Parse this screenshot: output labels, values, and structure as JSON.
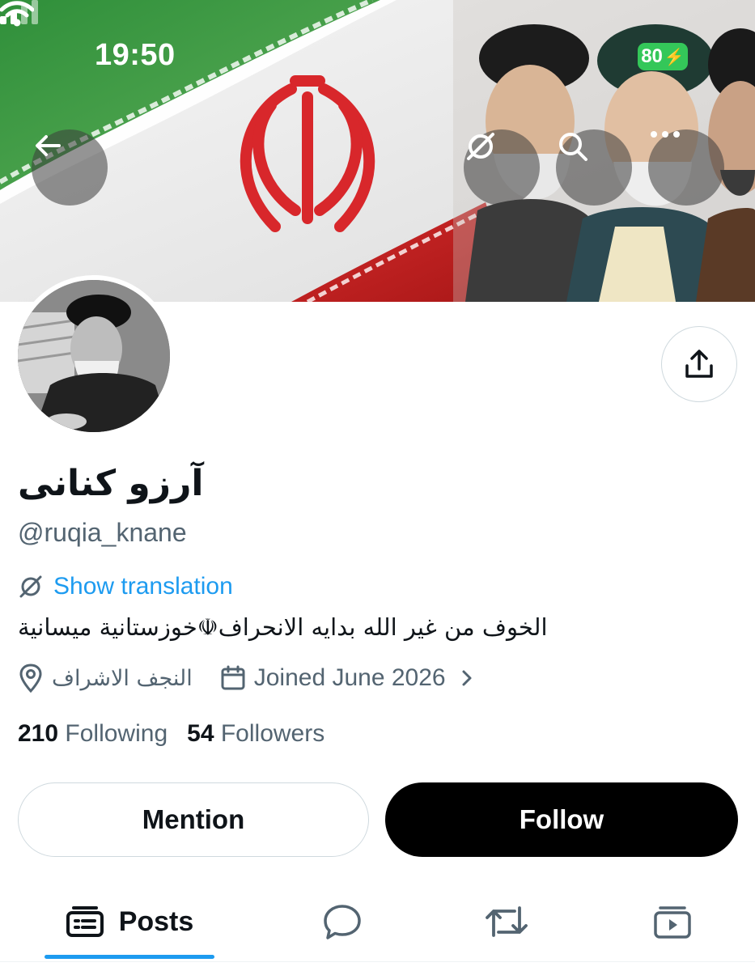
{
  "status_bar": {
    "time": "19:50",
    "battery": "80",
    "icons": [
      "signal-icon",
      "wifi-icon",
      "battery-charging-icon"
    ]
  },
  "header": {
    "icons": [
      "back-arrow-icon",
      "translate-icon",
      "search-icon",
      "more-icon"
    ]
  },
  "profile": {
    "display_name": "آرزو کنانی",
    "handle": "@ruqia_knane",
    "show_translation": "Show translation",
    "bio": "الخوف من غير الله بدايه الانحراف☫خوزستانية ميسانية",
    "location": "النجف الاشراف",
    "joined": "Joined June 2026",
    "following_count": "210",
    "following_label": "Following",
    "followers_count": "54",
    "followers_label": "Followers"
  },
  "actions": {
    "mention_label": "Mention",
    "follow_label": "Follow",
    "share_icon": "share-icon"
  },
  "tabs": {
    "posts_label": "Posts",
    "icons": [
      "posts-icon",
      "replies-icon",
      "reposts-icon",
      "media-icon"
    ]
  },
  "colors": {
    "accent": "#1d9bf0",
    "text": "#0f1419",
    "secondary": "#536471",
    "battery": "#34c759"
  }
}
